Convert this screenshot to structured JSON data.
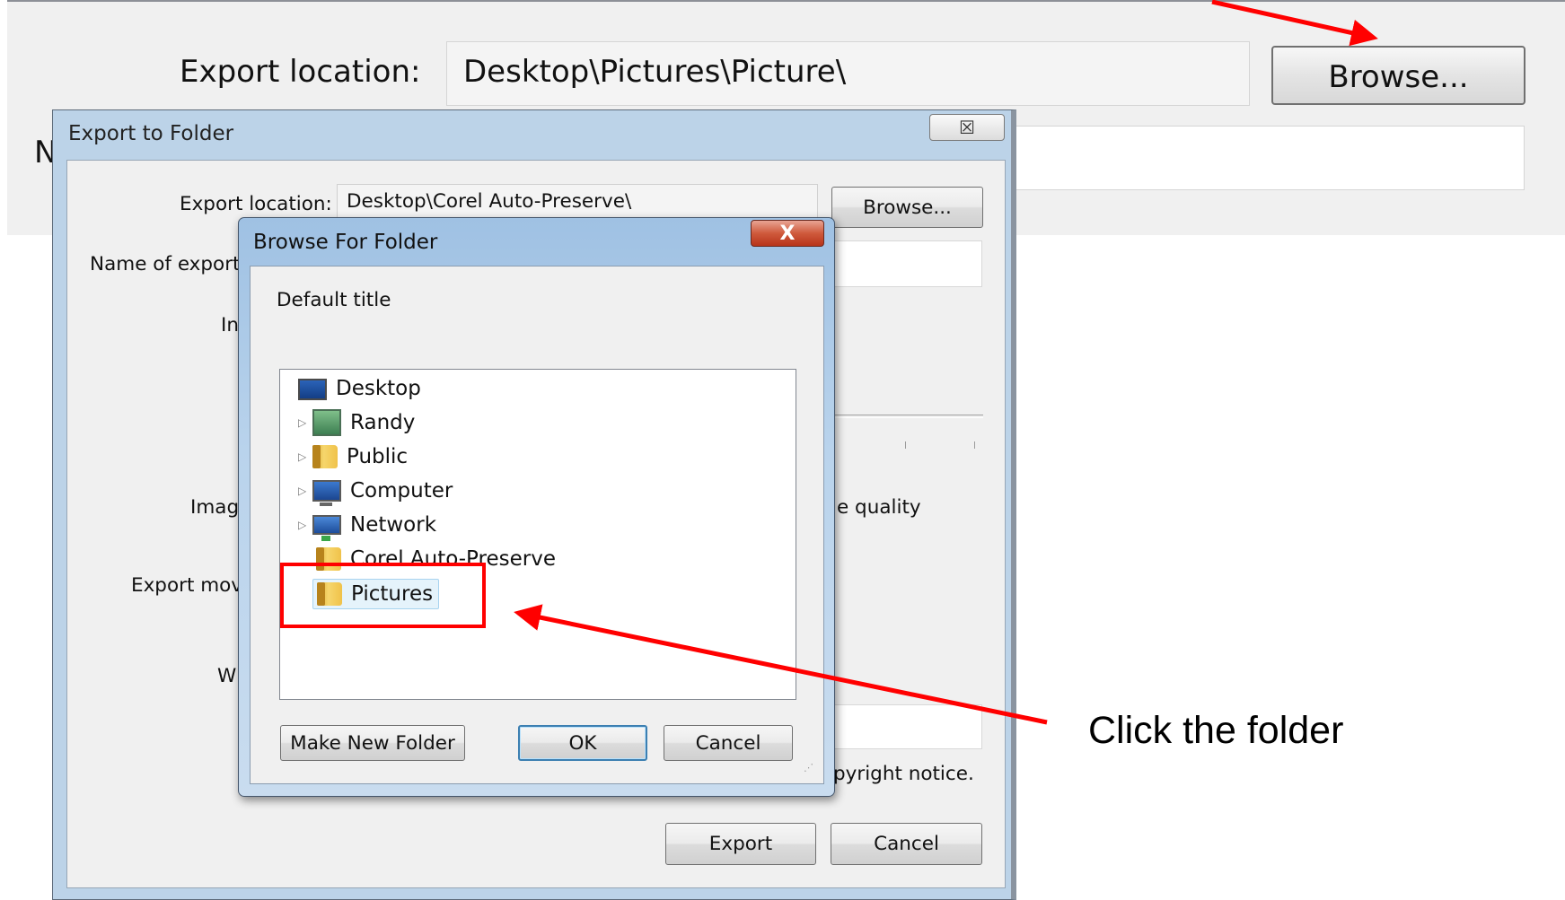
{
  "background": {
    "export_location_label": "Export location:",
    "export_location_value": "Desktop\\Pictures\\Picture\\",
    "browse_label": "Browse...",
    "partial_label": "N"
  },
  "export_dialog": {
    "title": "Export to Folder",
    "close_glyph": "☒",
    "export_location_label": "Export location:",
    "export_location_value": "Desktop\\Corel Auto-Preserve\\",
    "browse_label": "Browse...",
    "name_label_partial": "Name of export",
    "partial_labels": [
      "In",
      "Imag",
      "Export mov",
      "W"
    ],
    "image_quality_partial": "e quality",
    "copyright_partial": "pyright notice.",
    "export_button": "Export",
    "cancel_button": "Cancel"
  },
  "browse_dialog": {
    "title": "Browse For Folder",
    "close_glyph": "X",
    "default_title": "Default title",
    "tree": [
      {
        "label": "Desktop",
        "icon": "desktop-icon",
        "expander": false,
        "level": 0
      },
      {
        "label": "Randy",
        "icon": "user-folder-icon",
        "expander": true,
        "level": 1
      },
      {
        "label": "Public",
        "icon": "folder-icon",
        "expander": true,
        "level": 1
      },
      {
        "label": "Computer",
        "icon": "computer-icon",
        "expander": true,
        "level": 1
      },
      {
        "label": "Network",
        "icon": "network-icon",
        "expander": true,
        "level": 1
      },
      {
        "label": "Corel Auto-Preserve",
        "icon": "folder-icon",
        "expander": false,
        "level": 1
      },
      {
        "label": "Pictures",
        "icon": "folder-icon",
        "expander": false,
        "level": 1,
        "selected": true
      }
    ],
    "make_new_folder_button": "Make New Folder",
    "ok_button": "OK",
    "cancel_button": "Cancel"
  },
  "annotation": {
    "text": "Click the folder",
    "color": "#ff0000"
  }
}
